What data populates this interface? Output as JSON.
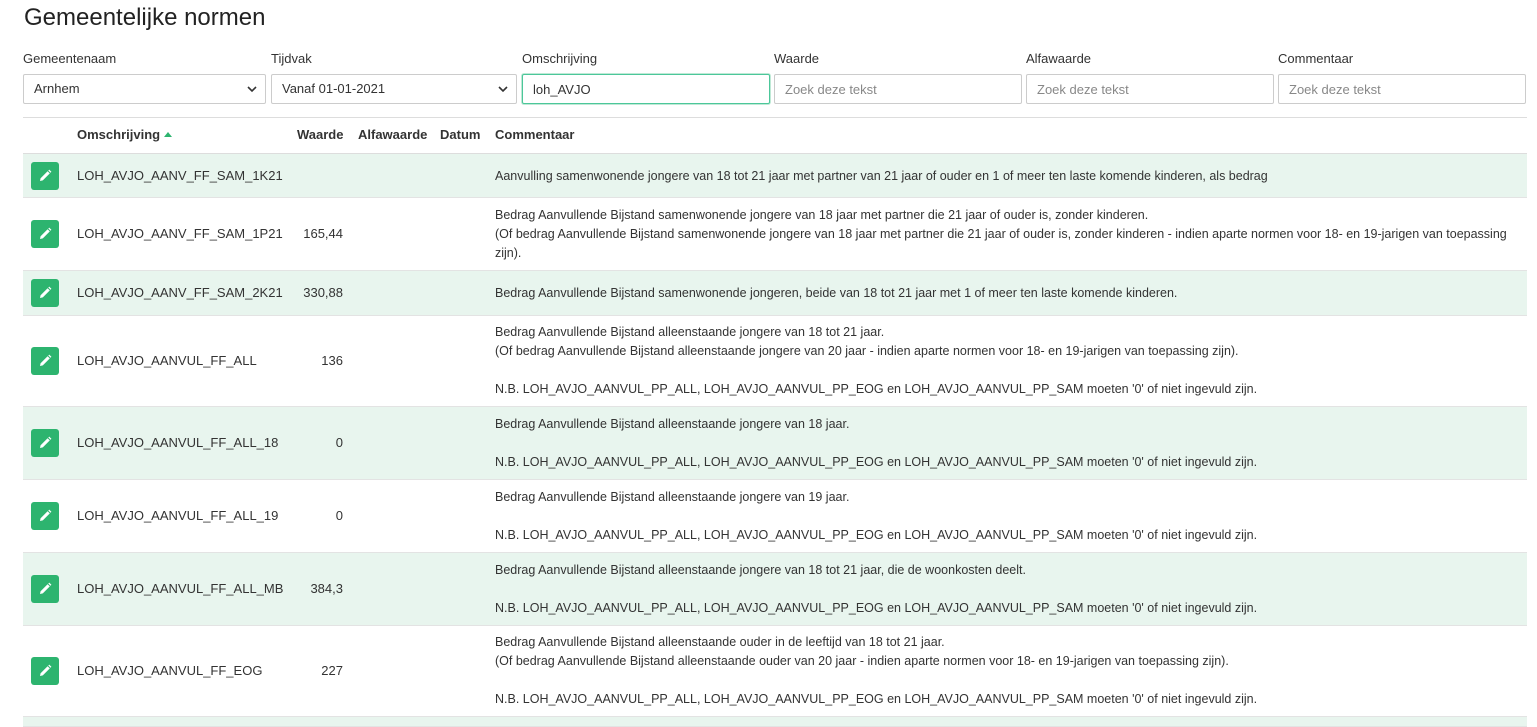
{
  "page": {
    "title": "Gemeentelijke normen"
  },
  "filters": {
    "gemeentenaam": {
      "label": "Gemeentenaam",
      "value": "Arnhem"
    },
    "tijdvak": {
      "label": "Tijdvak",
      "value": "Vanaf 01-01-2021"
    },
    "omschrijving": {
      "label": "Omschrijving",
      "value": "loh_AVJO"
    },
    "waarde": {
      "label": "Waarde",
      "placeholder": "Zoek deze tekst"
    },
    "alfawaarde": {
      "label": "Alfawaarde",
      "placeholder": "Zoek deze tekst"
    },
    "commentaar": {
      "label": "Commentaar",
      "placeholder": "Zoek deze tekst"
    }
  },
  "table": {
    "headers": {
      "omschrijving": "Omschrijving",
      "waarde": "Waarde",
      "alfawaarde": "Alfawaarde",
      "datum": "Datum",
      "commentaar": "Commentaar"
    },
    "rows": [
      {
        "code": "LOH_AVJO_AANV_FF_SAM_1K21",
        "waarde": "",
        "comment": [
          "Aanvulling samenwonende jongere van 18 tot 21 jaar met partner van 21 jaar of ouder en 1 of meer ten laste komende kinderen, als bedrag"
        ]
      },
      {
        "code": "LOH_AVJO_AANV_FF_SAM_1P21",
        "waarde": "165,44",
        "comment": [
          "Bedrag Aanvullende Bijstand samenwonende jongere van 18 jaar met partner die 21 jaar of ouder is, zonder kinderen.",
          "(Of bedrag Aanvullende Bijstand samenwonende jongere van 18 jaar met partner die 21 jaar of ouder is, zonder kinderen - indien aparte normen voor 18- en 19-jarigen van toepassing",
          "zijn)."
        ]
      },
      {
        "code": "LOH_AVJO_AANV_FF_SAM_2K21",
        "waarde": "330,88",
        "comment": [
          "Bedrag Aanvullende Bijstand samenwonende jongeren, beide van 18 tot 21 jaar met 1 of meer ten laste komende kinderen."
        ]
      },
      {
        "code": "LOH_AVJO_AANVUL_FF_ALL",
        "waarde": "136",
        "comment": [
          "Bedrag Aanvullende Bijstand alleenstaande jongere van 18 tot 21 jaar.",
          "(Of bedrag Aanvullende Bijstand alleenstaande jongere van 20 jaar - indien aparte normen voor 18- en 19-jarigen van toepassing zijn).",
          "",
          "N.B. LOH_AVJO_AANVUL_PP_ALL, LOH_AVJO_AANVUL_PP_EOG en LOH_AVJO_AANVUL_PP_SAM moeten '0' of niet ingevuld zijn."
        ]
      },
      {
        "code": "LOH_AVJO_AANVUL_FF_ALL_18",
        "waarde": "0",
        "comment": [
          "Bedrag Aanvullende Bijstand alleenstaande jongere van 18 jaar.",
          "",
          "N.B. LOH_AVJO_AANVUL_PP_ALL, LOH_AVJO_AANVUL_PP_EOG en LOH_AVJO_AANVUL_PP_SAM moeten '0' of niet ingevuld zijn."
        ]
      },
      {
        "code": "LOH_AVJO_AANVUL_FF_ALL_19",
        "waarde": "0",
        "comment": [
          "Bedrag Aanvullende Bijstand alleenstaande jongere van 19 jaar.",
          "",
          "N.B. LOH_AVJO_AANVUL_PP_ALL, LOH_AVJO_AANVUL_PP_EOG en LOH_AVJO_AANVUL_PP_SAM moeten '0' of niet ingevuld zijn."
        ]
      },
      {
        "code": "LOH_AVJO_AANVUL_FF_ALL_MB",
        "waarde": "384,3",
        "comment": [
          "Bedrag Aanvullende Bijstand alleenstaande jongere van 18 tot 21 jaar, die de woonkosten deelt.",
          "",
          "N.B. LOH_AVJO_AANVUL_PP_ALL, LOH_AVJO_AANVUL_PP_EOG en LOH_AVJO_AANVUL_PP_SAM moeten '0' of niet ingevuld zijn."
        ]
      },
      {
        "code": "LOH_AVJO_AANVUL_FF_EOG",
        "waarde": "227",
        "comment": [
          "Bedrag Aanvullende Bijstand alleenstaande ouder in de leeftijd van 18 tot 21 jaar.",
          "(Of bedrag Aanvullende Bijstand alleenstaande ouder van 20 jaar - indien aparte normen voor 18- en 19-jarigen van toepassing zijn).",
          "",
          "N.B. LOH_AVJO_AANVUL_PP_ALL, LOH_AVJO_AANVUL_PP_EOG en LOH_AVJO_AANVUL_PP_SAM moeten '0' of niet ingevuld zijn."
        ]
      },
      {
        "code": "",
        "waarde": "",
        "comment": []
      }
    ]
  },
  "colors": {
    "accent": "#2db46f",
    "row_alt": "#e8f5ee",
    "focus_border": "#4cc79a"
  },
  "icons": {
    "edit": "pencil-icon",
    "select": "chevron-down-icon",
    "sort": "sort-asc-icon"
  }
}
